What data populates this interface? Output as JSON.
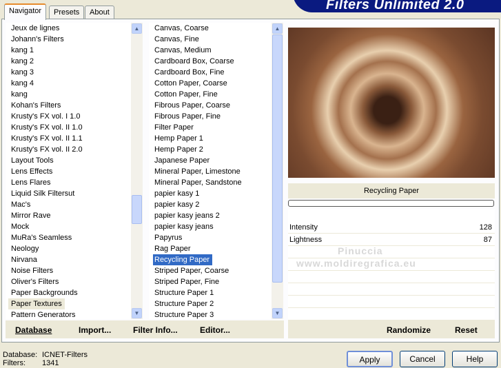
{
  "app": {
    "title": "Filters Unlimited 2.0"
  },
  "tabs": [
    {
      "label": "Navigator"
    },
    {
      "label": "Presets"
    },
    {
      "label": "About"
    }
  ],
  "categories": [
    "Jeux de lignes",
    "Johann's Filters",
    "kang 1",
    "kang 2",
    "kang 3",
    "kang 4",
    "kang",
    "Kohan's Filters",
    "Krusty's FX vol. I 1.0",
    "Krusty's FX vol. II 1.0",
    "Krusty's FX vol. II 1.1",
    "Krusty's FX vol. II 2.0",
    "Layout Tools",
    "Lens Effects",
    "Lens Flares",
    "Liquid Silk Filtersut",
    "Mac's",
    "Mirror Rave",
    "Mock",
    "MuRa's Seamless",
    "Neology",
    "Nirvana",
    "Noise Filters",
    "Oliver's Filters",
    "Paper Backgrounds",
    "Paper Textures",
    "Pattern Generators"
  ],
  "selected_category": "Paper Textures",
  "filters": [
    "Canvas, Coarse",
    "Canvas, Fine",
    "Canvas, Medium",
    "Cardboard Box, Coarse",
    "Cardboard Box, Fine",
    "Cotton Paper, Coarse",
    "Cotton Paper, Fine",
    "Fibrous Paper, Coarse",
    "Fibrous Paper, Fine",
    "Filter Paper",
    "Hemp Paper 1",
    "Hemp Paper 2",
    "Japanese Paper",
    "Mineral Paper, Limestone",
    "Mineral Paper, Sandstone",
    "papier kasy 1",
    "papier kasy 2",
    "papier kasy jeans 2",
    "papier kasy jeans",
    "Papyrus",
    "Rag Paper",
    "Recycling Paper",
    "Striped Paper, Coarse",
    "Striped Paper, Fine",
    "Structure Paper 1",
    "Structure Paper 2",
    "Structure Paper 3"
  ],
  "selected_filter": "Recycling Paper",
  "filter_name": "Recycling Paper",
  "params": [
    {
      "label": "Intensity",
      "value": "128"
    },
    {
      "label": "Lightness",
      "value": "87"
    }
  ],
  "watermark": {
    "line1": "Pinuccia",
    "line2": "www.moldiregrafica.eu"
  },
  "left_buttons": {
    "database": "Database",
    "import": "Import...",
    "filter_info": "Filter Info...",
    "editor": "Editor..."
  },
  "right_buttons": {
    "randomize": "Randomize",
    "reset": "Reset"
  },
  "status": {
    "database_label": "Database:",
    "database_value": "ICNET-Filters",
    "filters_label": "Filters:",
    "filters_value": "1341"
  },
  "dialog_buttons": {
    "apply": "Apply",
    "cancel": "Cancel",
    "help": "Help"
  }
}
